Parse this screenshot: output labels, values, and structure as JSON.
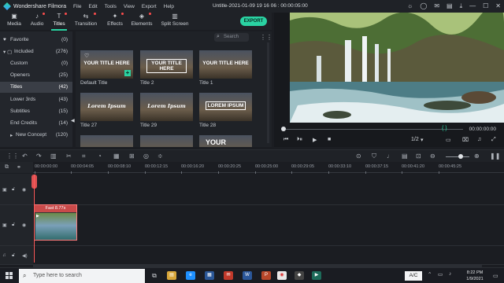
{
  "app": {
    "name": "Wondershare Filmora",
    "doc_title": "Untitle-2021-01-09 19 16 06 : 00:00:05:00"
  },
  "menu": [
    "File",
    "Edit",
    "Tools",
    "View",
    "Export",
    "Help"
  ],
  "toolbar": {
    "tabs": [
      {
        "label": "Media",
        "icon": "folder-icon",
        "glyph": "▣"
      },
      {
        "label": "Audio",
        "icon": "music-note-icon",
        "glyph": "♪"
      },
      {
        "label": "Titles",
        "icon": "text-icon",
        "glyph": "T"
      },
      {
        "label": "Transition",
        "icon": "transition-icon",
        "glyph": "⇆"
      },
      {
        "label": "Effects",
        "icon": "effects-icon",
        "glyph": "✦"
      },
      {
        "label": "Elements",
        "icon": "elements-icon",
        "glyph": "◈"
      },
      {
        "label": "Split Screen",
        "icon": "split-screen-icon",
        "glyph": "▥"
      }
    ],
    "active_tab": "Titles",
    "export_label": "EXPORT"
  },
  "library_tree": [
    {
      "lead": "♥",
      "name": "Favorite",
      "count": "(0)"
    },
    {
      "lead": "▾ ▢",
      "name": "Included",
      "count": "(276)"
    },
    {
      "lead": "",
      "name": "Custom",
      "count": "(0)"
    },
    {
      "lead": "",
      "name": "Openers",
      "count": "(25)"
    },
    {
      "lead": "",
      "name": "Titles",
      "count": "(42)",
      "selected": true
    },
    {
      "lead": "",
      "name": "Lower 3rds",
      "count": "(43)"
    },
    {
      "lead": "",
      "name": "Subtitles",
      "count": "(15)"
    },
    {
      "lead": "",
      "name": "End Credits",
      "count": "(14)"
    },
    {
      "lead": "▸",
      "name": "New Concept",
      "count": "(120)"
    }
  ],
  "search": {
    "placeholder": "Search"
  },
  "titles": [
    {
      "label": "Default Title",
      "text": "YOUR TITLE HERE",
      "style": "plain",
      "sub": "",
      "favorite": true,
      "add": true
    },
    {
      "label": "Title 2",
      "text": "YOUR TITLE HERE",
      "style": "box",
      "sub": "",
      "favorite": false,
      "add": false
    },
    {
      "label": "Title 1",
      "text": "YOUR TITLE HERE",
      "style": "plain",
      "sub": "",
      "favorite": false,
      "add": false
    },
    {
      "label": "Title 27",
      "text": "Lorem Ipsum",
      "style": "italic",
      "sub": "",
      "favorite": false,
      "add": false
    },
    {
      "label": "Title 29",
      "text": "Lorem Ipsum",
      "style": "italic",
      "sub": "",
      "favorite": false,
      "add": false
    },
    {
      "label": "Title 28",
      "text": "LOREM IPSUM",
      "style": "box",
      "sub": "",
      "favorite": false,
      "add": false
    },
    {
      "label": "",
      "text": "",
      "style": "plain",
      "sub": "",
      "favorite": false,
      "add": false
    },
    {
      "label": "",
      "text": "",
      "style": "plain",
      "sub": "",
      "favorite": false,
      "add": false
    },
    {
      "label": "",
      "text": "YOUR",
      "style": "plain",
      "sub": "",
      "favorite": false,
      "add": false
    }
  ],
  "preview": {
    "time": "00:00:00:00",
    "ratio": "1/2",
    "progress": 0
  },
  "timeline": {
    "ticks": [
      "00:00:00:00",
      "00:00:04:05",
      "00:00:08:10",
      "00:00:12:15",
      "00:00:16:20",
      "00:00:20:25",
      "00:00:25:00",
      "00:00:29:05",
      "00:00:33:10",
      "00:00:37:15",
      "00:00:41:20",
      "00:00:45:25"
    ],
    "clip_title": "Fast 8.77x"
  },
  "taskbar": {
    "search_placeholder": "Type here to search",
    "language": "A/C",
    "time": "8:22 PM",
    "date": "1/9/2021"
  },
  "colors": {
    "accent": "#2ad3a3",
    "playhead": "#ff5a5a",
    "clip_header": "#c94a4a"
  }
}
